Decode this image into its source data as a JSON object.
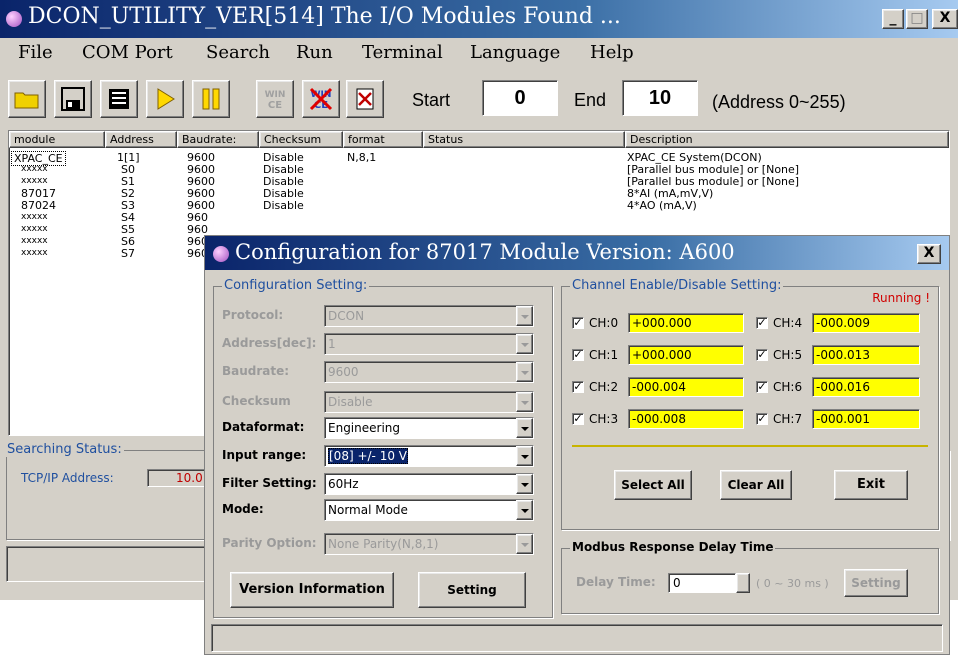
{
  "window": {
    "title": "DCON_UTILITY_VER[514] The I/O Modules Found ...",
    "min_label": "_",
    "max_label": "□",
    "close_label": "X"
  },
  "menu": [
    "File",
    "COM Port",
    "Search",
    "Run",
    "Terminal",
    "Language",
    "Help"
  ],
  "toolbar": {
    "icons": [
      "open-folder-icon",
      "save-disk-icon",
      "print-icon",
      "run-play-icon",
      "pause-icon",
      "wince-icon",
      "wince-cross-icon",
      "stop-icon"
    ],
    "start_label": "Start",
    "start_value": "0",
    "end_label": "End",
    "end_value": "10",
    "address_range": "(Address 0~255)"
  },
  "list": {
    "columns": [
      "module",
      "Address",
      "Baudrate:",
      "Checksum",
      "format",
      "Status",
      "Description"
    ],
    "rows": [
      [
        "XPAC_CE",
        "1[1]",
        "9600",
        "Disable",
        "N,8,1",
        "",
        "XPAC_CE System(DCON)"
      ],
      [
        "xxxxx",
        "S0",
        "9600",
        "Disable",
        "",
        "",
        "[Parallel bus module] or [None]"
      ],
      [
        "xxxxx",
        "S1",
        "9600",
        "Disable",
        "",
        "",
        "[Parallel bus module] or [None]"
      ],
      [
        "87017",
        "S2",
        "9600",
        "Disable",
        "",
        "",
        "8*AI (mA,mV,V)"
      ],
      [
        "87024",
        "S3",
        "9600",
        "Disable",
        "",
        "",
        "4*AO (mA,V)"
      ],
      [
        "xxxxx",
        "S4",
        "960",
        "",
        "",
        "",
        ""
      ],
      [
        "xxxxx",
        "S5",
        "960",
        "",
        "",
        "",
        ""
      ],
      [
        "xxxxx",
        "S6",
        "960",
        "",
        "",
        "",
        ""
      ],
      [
        "xxxxx",
        "S7",
        "960",
        "",
        "",
        "",
        ""
      ]
    ]
  },
  "search_status": {
    "title": "Searching Status:",
    "tcp_label": "TCP/IP Address:",
    "tcp_value": "10.0"
  },
  "dialog": {
    "title": "Configuration for 87017 Module Version: A600",
    "close_label": "X",
    "config_group": "Configuration Setting:",
    "fields": [
      {
        "label": "Protocol:",
        "value": "DCON",
        "enabled": false,
        "type": "combo"
      },
      {
        "label": "Address[dec]:",
        "value": "1",
        "enabled": false,
        "type": "spin"
      },
      {
        "label": "Baudrate:",
        "value": "9600",
        "enabled": false,
        "type": "combo"
      },
      {
        "label": "Checksum",
        "value": "Disable",
        "enabled": false,
        "type": "combo"
      },
      {
        "label": "Dataformat:",
        "value": "Engineering",
        "enabled": true,
        "type": "combo"
      },
      {
        "label": "Input range:",
        "value": "[08] +/- 10 V",
        "enabled": true,
        "type": "combo"
      },
      {
        "label": "Filter Setting:",
        "value": "60Hz",
        "enabled": true,
        "type": "combo"
      },
      {
        "label": "Mode:",
        "value": "Normal Mode",
        "enabled": true,
        "type": "combo"
      },
      {
        "label": "Parity Option:",
        "value": "None Parity(N,8,1)",
        "enabled": false,
        "type": "combo"
      }
    ],
    "version_button": "Version Information",
    "setting_button": "Setting",
    "channel_group": "Channel Enable/Disable Setting:",
    "running": "Running !",
    "channels": [
      {
        "label": "CH:0",
        "value": "+000.000",
        "checked": true
      },
      {
        "label": "CH:1",
        "value": "+000.000",
        "checked": true
      },
      {
        "label": "CH:2",
        "value": "-000.004",
        "checked": true
      },
      {
        "label": "CH:3",
        "value": "-000.008",
        "checked": true
      },
      {
        "label": "CH:4",
        "value": "-000.009",
        "checked": true
      },
      {
        "label": "CH:5",
        "value": "-000.013",
        "checked": true
      },
      {
        "label": "CH:6",
        "value": "-000.016",
        "checked": true
      },
      {
        "label": "CH:7",
        "value": "-000.001",
        "checked": true
      }
    ],
    "select_all": "Select All",
    "clear_all": "Clear All",
    "exit": "Exit",
    "modbus_group": "Modbus Response Delay Time",
    "delay_label": "Delay Time:",
    "delay_value": "0",
    "delay_range": "( 0 ~ 30 ms )",
    "delay_setting": "Setting"
  },
  "colors": {
    "title_start": "#0a246a",
    "title_end": "#a6caf0",
    "face": "#d4d0c8",
    "channel_value_bg": "#ffff00",
    "running_text": "#d00000",
    "group_title": "#1f4f9f"
  }
}
